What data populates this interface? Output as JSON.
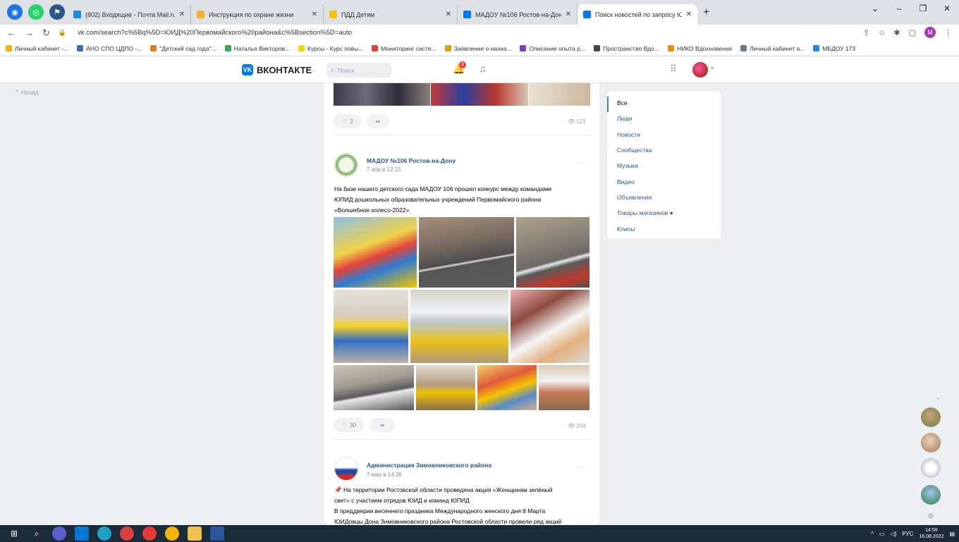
{
  "browser": {
    "tabs": [
      {
        "title": "(802) Входящие - Почта Mail.ru",
        "color": "#168de2"
      },
      {
        "title": "Инструкция по охране жизни",
        "color": "#f0b429"
      },
      {
        "title": "ПДД Детям",
        "color": "#f3c200"
      },
      {
        "title": "МАДОУ №106 Ростов-на-Дону",
        "color": "#0077ff"
      },
      {
        "title": "Поиск новостей по запросу Ю",
        "color": "#0077ff",
        "active": true
      }
    ],
    "url": "vk.com/search?c%5Bq%5D=ЮИД%20Первомайского%20района&c%5Bsection%5D=auto",
    "bookmarks": [
      "Личный кабинет -...",
      "АНО СПО ЦДПО -...",
      "\"Детский сад года\"...",
      "Наталья Викторов...",
      "Курсы - Курс повы...",
      "Мониторинг систе...",
      "Заявление о назна...",
      "Описание опыта р...",
      "Пространство Вдо...",
      "НИКО Вдохновение",
      "Личный кабинет а...",
      "МБДОУ 173"
    ]
  },
  "vk": {
    "logo": "ВКОНТАКТЕ",
    "search_placeholder": "Поиск",
    "notif_count": "9",
    "back_label": "Назад"
  },
  "feed": {
    "post0": {
      "likes": "2",
      "views": "121"
    },
    "post1": {
      "author": "МАДОУ №106 Ростов-на-Дону",
      "date": "7 апр в 12:15",
      "text": [
        "На базе нашего детского сада МАДОУ 106 прошел конкурс между командами",
        "ЮПИД дошкольных образовательных учреждений Первомайского района",
        "«Волшебное колесо-2022»"
      ],
      "likes": "30",
      "views": "204"
    },
    "post2": {
      "author": "Администрация Зимовниковского района",
      "date": "7 мар в 14:36",
      "text": [
        "📌 На территории Ростовской области проведена акция «Женщинам зелёный",
        "свет» с участием отрядов ЮИД и команд ЮПИД",
        "В преддверии весеннего праздника Международного женского дня 8 Марта",
        "ЮИДовцы Дона Зимовниковского района Ростовской области провели ряд акций"
      ]
    }
  },
  "filters": [
    "Все",
    "Люди",
    "Новости",
    "Сообщества",
    "Музыка",
    "Видео",
    "Объявления",
    "Товары магазинов ●",
    "Клипы"
  ],
  "tray": {
    "lang": "РУС",
    "time": "14:59",
    "date": "16.08.2022"
  }
}
